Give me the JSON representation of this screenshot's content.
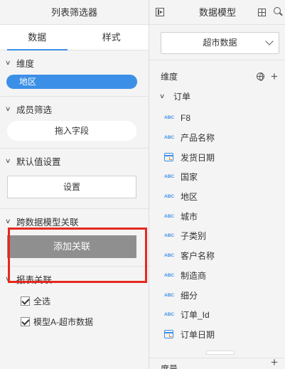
{
  "filter_panel": {
    "title": "列表筛选器",
    "tabs": [
      {
        "label": "数据",
        "active": true
      },
      {
        "label": "样式",
        "active": false
      }
    ],
    "dimension": {
      "title": "维度",
      "chip": "地区"
    },
    "member_filter": {
      "title": "成员筛选",
      "drop_placeholder": "拖入字段"
    },
    "default_value": {
      "title": "默认值设置",
      "button": "设置"
    },
    "cross_model": {
      "title": "跨数据模型关联",
      "button": "添加关联"
    },
    "report_link": {
      "title": "报表关联",
      "options": [
        {
          "label": "全选",
          "checked": true
        },
        {
          "label": "模型A-超市数据",
          "checked": true
        }
      ]
    }
  },
  "model_panel": {
    "title": "数据模型",
    "selected_model": "超市数据",
    "dimension_label": "维度",
    "group": "订单",
    "fields": [
      {
        "type": "abc",
        "icon": "ABC",
        "label": "F8"
      },
      {
        "type": "abc",
        "icon": "ABC",
        "label": "产品名称"
      },
      {
        "type": "date",
        "icon": "calendar-icon",
        "label": "发货日期"
      },
      {
        "type": "abc",
        "icon": "ABC",
        "label": "国家"
      },
      {
        "type": "abc",
        "icon": "ABC",
        "label": "地区"
      },
      {
        "type": "abc",
        "icon": "ABC",
        "label": "城市"
      },
      {
        "type": "abc",
        "icon": "ABC",
        "label": "子类别"
      },
      {
        "type": "abc",
        "icon": "ABC",
        "label": "客户名称"
      },
      {
        "type": "abc",
        "icon": "ABC",
        "label": "制造商"
      },
      {
        "type": "abc",
        "icon": "ABC",
        "label": "细分"
      },
      {
        "type": "abc",
        "icon": "ABC",
        "label": "订单_Id"
      },
      {
        "type": "date",
        "icon": "calendar-icon",
        "label": "订单日期"
      }
    ],
    "measure_label": "度量"
  },
  "colors": {
    "accent": "#3c8fe6",
    "highlight_border": "#e5281e",
    "disabled_button": "#8f8f8f"
  }
}
